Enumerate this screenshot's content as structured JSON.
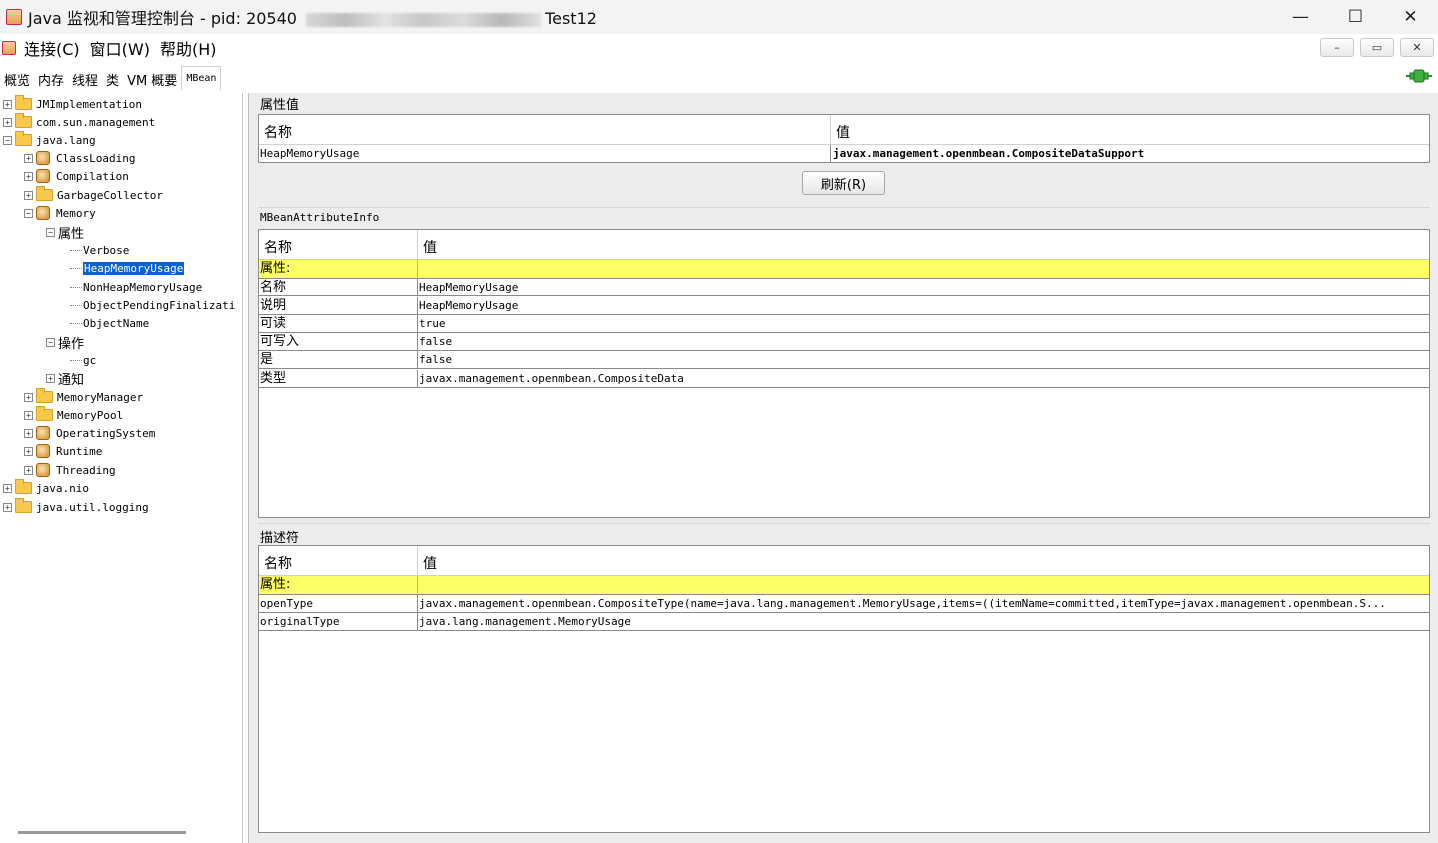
{
  "window": {
    "title_prefix": "Java 监视和管理控制台 - pid: 20540",
    "title_suffix": "Test12",
    "minimize": "—",
    "maximize": "☐",
    "close": "✕"
  },
  "menu": {
    "items": [
      "连接(C)",
      "窗口(W)",
      "帮助(H)"
    ],
    "inner_minimize": "–",
    "inner_restore": "▭",
    "inner_close": "✕"
  },
  "tabs": [
    "概览",
    "内存",
    "线程",
    "类",
    "VM 概要",
    "MBean"
  ],
  "tree": {
    "nodes": [
      {
        "label": "JMImplementation"
      },
      {
        "label": "com.sun.management"
      },
      {
        "label": "java.lang"
      },
      {
        "label": "ClassLoading"
      },
      {
        "label": "Compilation"
      },
      {
        "label": "GarbageCollector"
      },
      {
        "label": "Memory"
      },
      {
        "label": "属性"
      },
      {
        "label": "Verbose"
      },
      {
        "label": "HeapMemoryUsage"
      },
      {
        "label": "NonHeapMemoryUsage"
      },
      {
        "label": "ObjectPendingFinalizati"
      },
      {
        "label": "ObjectName"
      },
      {
        "label": "操作"
      },
      {
        "label": "gc"
      },
      {
        "label": "通知"
      },
      {
        "label": "MemoryManager"
      },
      {
        "label": "MemoryPool"
      },
      {
        "label": "OperatingSystem"
      },
      {
        "label": "Runtime"
      },
      {
        "label": "Threading"
      },
      {
        "label": "java.nio"
      },
      {
        "label": "java.util.logging"
      }
    ]
  },
  "attr_values": {
    "title": "属性值",
    "col_name": "名称",
    "col_value": "值",
    "rows": [
      {
        "name": "HeapMemoryUsage",
        "value": "javax.management.openmbean.CompositeDataSupport"
      }
    ],
    "refresh_label": "刷新(R)"
  },
  "attr_info": {
    "title": "MBeanAttributeInfo",
    "col_name": "名称",
    "col_value": "值",
    "section": "属性:",
    "rows": [
      {
        "name": "名称",
        "value": "HeapMemoryUsage"
      },
      {
        "name": "说明",
        "value": "HeapMemoryUsage"
      },
      {
        "name": "可读",
        "value": "true"
      },
      {
        "name": "可写入",
        "value": "false"
      },
      {
        "name": "是",
        "value": "false"
      },
      {
        "name": "类型",
        "value": "javax.management.openmbean.CompositeData"
      }
    ]
  },
  "descriptor": {
    "title": "描述符",
    "col_name": "名称",
    "col_value": "值",
    "section": "属性:",
    "rows": [
      {
        "name": "openType",
        "value": "javax.management.openmbean.CompositeType(name=java.lang.management.MemoryUsage,items=((itemName=committed,itemType=javax.management.openmbean.S..."
      },
      {
        "name": "originalType",
        "value": "java.lang.management.MemoryUsage"
      }
    ]
  },
  "colors": {
    "selection": "#0a63d1",
    "highlight_row": "#ffff66",
    "folder": "#f7c84a"
  }
}
